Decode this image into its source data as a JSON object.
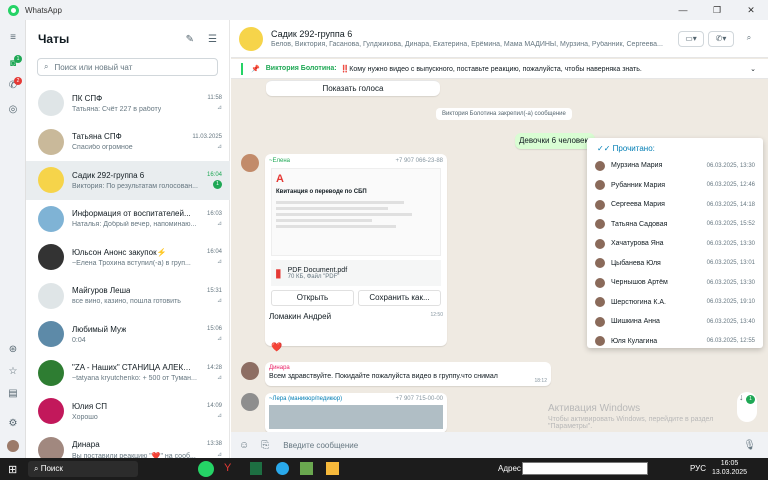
{
  "window": {
    "title": "WhatsApp"
  },
  "chats_panel": {
    "title": "Чаты",
    "search_placeholder": "Поиск или новый чат"
  },
  "rail": {
    "badge_chats": "1",
    "badge_status": "2"
  },
  "chats": [
    {
      "name": "ПК СПФ",
      "time": "11:58",
      "message": "Татьяна: Счёт 227 в работу",
      "avatar_color": "#dfe5e7"
    },
    {
      "name": "Татьяна СПФ",
      "time": "11.03.2025",
      "message": "Спасибо огромное",
      "avatar_color": "#c9b99a"
    },
    {
      "name": "Садик 292-группа 6",
      "time": "16:04",
      "message": "Виктория: По результатам голосован...",
      "unread": "1",
      "avatar_color": "#f6d44a"
    },
    {
      "name": "Информация от воспитателей...",
      "time": "16:03",
      "message": "Наталья: Добрый вечер, напоминаю...",
      "avatar_color": "#7fb3d5"
    },
    {
      "name": "Юльсон Анонс закупок⚡",
      "time": "16:04",
      "message": "~Елена Трохина вступил(-а) в груп...",
      "avatar_color": "#333333"
    },
    {
      "name": "Майгуров Леша",
      "time": "15:31",
      "message": "все вино, казино, пошла готовить",
      "avatar_color": "#dfe5e7"
    },
    {
      "name": "Любимый Муж",
      "time": "15:06",
      "message": "0:04",
      "avatar_color": "#5d8aa8"
    },
    {
      "name": "\"ZA - Наших\" СТАНИЦА АЛЕКС...",
      "time": "14:28",
      "message": "~tatyana kryutchenko: + 500 от Туман...",
      "avatar_color": "#2e7d32"
    },
    {
      "name": "Юлия СП",
      "time": "14:09",
      "message": "Хорошо",
      "avatar_color": "#c2185b"
    },
    {
      "name": "Динара",
      "time": "13:38",
      "message": "Вы поставили реакцию \"❤️\" на сооб...",
      "avatar_color": "#a1887f"
    }
  ],
  "chat_header": {
    "title": "Садик 292-группа 6",
    "subtitle": "Белов, Виктория, Гасанова, Гулджикова, Динара, Екатерина, Ерёмина, Мама МАДИНЫ, Мурзина, Рубанник, Сергеева..."
  },
  "pinned": {
    "author": "Виктория Болотина:",
    "text": "‼️Кому нужно видео с выпускного, поставьте реакцию, пожалуйста, чтобы наверняка знать."
  },
  "messages": {
    "show_voice": "Показать голоса",
    "system_pin": "Виктория Болотина закрепил(-а) сообщение",
    "out_text": "Девочки 6 человек",
    "elena_name": "~Елена",
    "elena_phone": "+7 907 066-23-88",
    "receipt_title": "Квитанция о переводе по СБП",
    "doc_name": "PDF Document.pdf",
    "doc_meta": "70 КБ, Файл \"PDF\"",
    "open_btn": "Открыть",
    "save_btn": "Сохранить как...",
    "doc_caption": "Ломакин Андрей",
    "doc_time": "12:50",
    "reaction": "❤️",
    "dinara_name": "Динара",
    "dinara_text": "Всем здравствуйте. Покидайте пожалуйста видео в группу.что снимал",
    "dinara_time": "18:12",
    "lera_name": "~Лера (маникюр/педикюр)",
    "lera_phone": "+7 907 715-00-00"
  },
  "read_popup": {
    "title": "Прочитано:",
    "rows": [
      {
        "name": "Мурзина Мария",
        "time": "06.03.2025, 13:30"
      },
      {
        "name": "Рубанник Мария",
        "time": "06.03.2025, 12:46"
      },
      {
        "name": "Сергеева Мария",
        "time": "06.03.2025, 14:18"
      },
      {
        "name": "Татьяна Садовая",
        "time": "06.03.2025, 15:52"
      },
      {
        "name": "Хачатурова Яна",
        "time": "06.03.2025, 13:30"
      },
      {
        "name": "Цыбанева Юля",
        "time": "06.03.2025, 13:01"
      },
      {
        "name": "Чернышов Артём",
        "time": "06.03.2025, 13:30"
      },
      {
        "name": "Шерстюгина К.А.",
        "time": "06.03.2025, 19:10"
      },
      {
        "name": "Шишкина Анна",
        "time": "06.03.2025, 13:40"
      },
      {
        "name": "Юля Кулагина",
        "time": "06.03.2025, 12:55"
      }
    ]
  },
  "scroll_badge": "1",
  "composer": {
    "placeholder": "Введите сообщение"
  },
  "watermark": {
    "line1": "Активация Windows",
    "line2": "Чтобы активировать Windows, перейдите в раздел \"Параметры\"."
  },
  "taskbar": {
    "search": "Поиск",
    "address_label": "Адрес",
    "lang": "РУС",
    "time": "16:05",
    "date": "13.03.2025"
  }
}
